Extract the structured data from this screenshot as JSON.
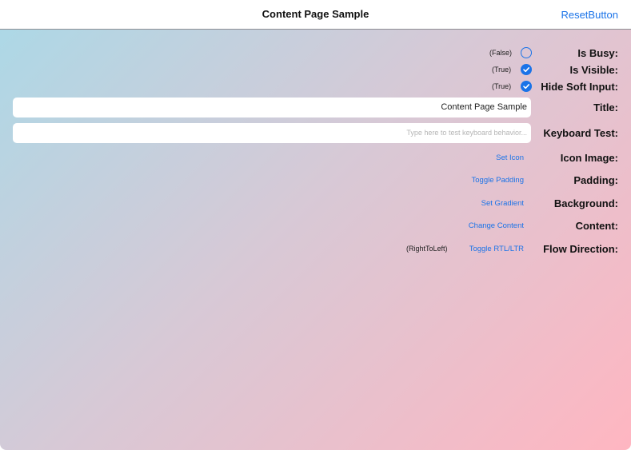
{
  "nav": {
    "title": "Content Page Sample",
    "action_label": "ResetButton"
  },
  "rows": {
    "is_busy": {
      "label": "Is Busy:",
      "value": "(False)",
      "checked": false
    },
    "is_visible": {
      "label": "Is Visible:",
      "value": "(True)",
      "checked": true
    },
    "hide_soft_input": {
      "label": "Hide Soft Input:",
      "value": "(True)",
      "checked": true
    },
    "title": {
      "label": "Title:",
      "value": "Content Page Sample"
    },
    "keyboard_test": {
      "label": "Keyboard Test:",
      "placeholder": "Type here to test keyboard behavior..."
    },
    "icon_image": {
      "label": "Icon Image:",
      "button": "Set Icon"
    },
    "padding": {
      "label": "Padding:",
      "button": "Toggle Padding"
    },
    "background": {
      "label": "Background:",
      "button": "Set Gradient"
    },
    "content": {
      "label": "Content:",
      "button": "Change Content"
    },
    "flow_direction": {
      "label": "Flow Direction:",
      "value": "(RightToLeft)",
      "button": "Toggle RTL/LTR"
    }
  },
  "colors": {
    "accent": "#1a73e8",
    "gradient_start": "#add8e6",
    "gradient_end": "#ffb6c1"
  }
}
